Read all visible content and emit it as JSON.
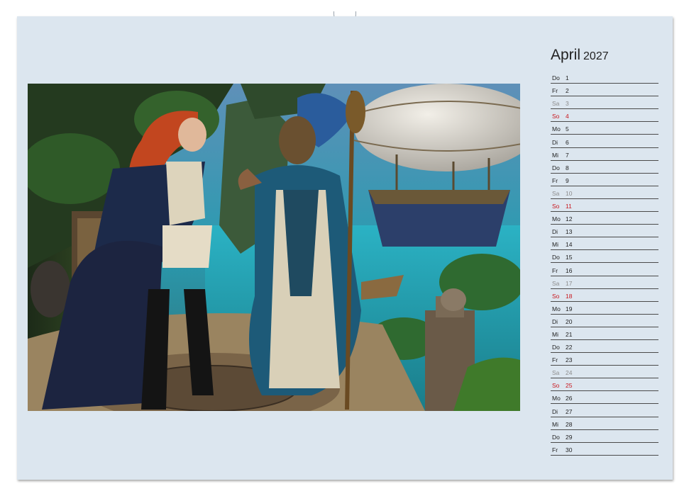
{
  "calendar": {
    "month": "April",
    "year": "2027",
    "days": [
      {
        "wd": "Do",
        "num": "1",
        "type": "weekday"
      },
      {
        "wd": "Fr",
        "num": "2",
        "type": "weekday"
      },
      {
        "wd": "Sa",
        "num": "3",
        "type": "sat"
      },
      {
        "wd": "So",
        "num": "4",
        "type": "sun"
      },
      {
        "wd": "Mo",
        "num": "5",
        "type": "weekday"
      },
      {
        "wd": "Di",
        "num": "6",
        "type": "weekday"
      },
      {
        "wd": "Mi",
        "num": "7",
        "type": "weekday"
      },
      {
        "wd": "Do",
        "num": "8",
        "type": "weekday"
      },
      {
        "wd": "Fr",
        "num": "9",
        "type": "weekday"
      },
      {
        "wd": "Sa",
        "num": "10",
        "type": "sat"
      },
      {
        "wd": "So",
        "num": "11",
        "type": "sun"
      },
      {
        "wd": "Mo",
        "num": "12",
        "type": "weekday"
      },
      {
        "wd": "Di",
        "num": "13",
        "type": "weekday"
      },
      {
        "wd": "Mi",
        "num": "14",
        "type": "weekday"
      },
      {
        "wd": "Do",
        "num": "15",
        "type": "weekday"
      },
      {
        "wd": "Fr",
        "num": "16",
        "type": "weekday"
      },
      {
        "wd": "Sa",
        "num": "17",
        "type": "sat"
      },
      {
        "wd": "So",
        "num": "18",
        "type": "sun"
      },
      {
        "wd": "Mo",
        "num": "19",
        "type": "weekday"
      },
      {
        "wd": "Di",
        "num": "20",
        "type": "weekday"
      },
      {
        "wd": "Mi",
        "num": "21",
        "type": "weekday"
      },
      {
        "wd": "Do",
        "num": "22",
        "type": "weekday"
      },
      {
        "wd": "Fr",
        "num": "23",
        "type": "weekday"
      },
      {
        "wd": "Sa",
        "num": "24",
        "type": "sat"
      },
      {
        "wd": "So",
        "num": "25",
        "type": "sun"
      },
      {
        "wd": "Mo",
        "num": "26",
        "type": "weekday"
      },
      {
        "wd": "Di",
        "num": "27",
        "type": "weekday"
      },
      {
        "wd": "Mi",
        "num": "28",
        "type": "weekday"
      },
      {
        "wd": "Do",
        "num": "29",
        "type": "weekday"
      },
      {
        "wd": "Fr",
        "num": "30",
        "type": "weekday"
      }
    ]
  },
  "colors": {
    "page_background": "#dce6ef",
    "weekday_text": "#222222",
    "saturday_text": "#8c8c8c",
    "sunday_text": "#c8161d"
  },
  "photo": {
    "subject": "fantasy-steampunk-pirates-illustration"
  }
}
